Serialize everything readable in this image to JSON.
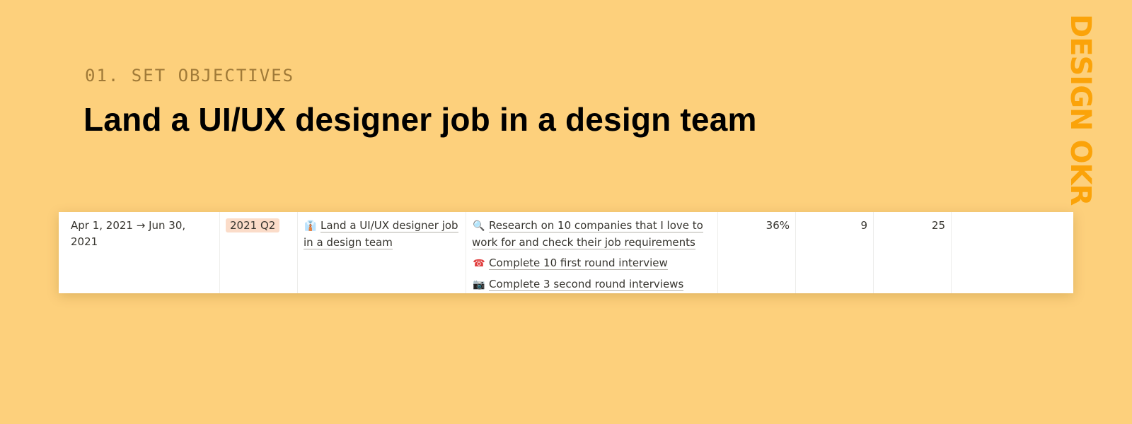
{
  "header": {
    "eyebrow": "01. SET OBJECTIVES",
    "title": "Land a UI/UX designer job in a design team"
  },
  "side_brand": "DESIGN OKR",
  "table": {
    "row": {
      "date_range": "Apr 1, 2021 → Jun 30, 2021",
      "quarter_tag": "2021 Q2",
      "objective": {
        "icon": "necktie-icon",
        "icon_glyph": "👔",
        "label": "Land a UI/UX designer job in a design team"
      },
      "key_results": [
        {
          "icon": "magnifier-icon",
          "icon_glyph": "🔍",
          "label": "Research on 10 companies that I love to work for and check their job requirements"
        },
        {
          "icon": "telephone-icon",
          "icon_glyph": "☎",
          "label": "Complete 10 first round interview"
        },
        {
          "icon": "camera-icon",
          "icon_glyph": "📷",
          "label": "Complete 3 second round interviews"
        }
      ],
      "progress": "36%",
      "value_a": "9",
      "value_b": "25"
    }
  },
  "colors": {
    "background": "#fdd07c",
    "brand": "#fba309",
    "tag_bg": "#fbdcc9"
  }
}
